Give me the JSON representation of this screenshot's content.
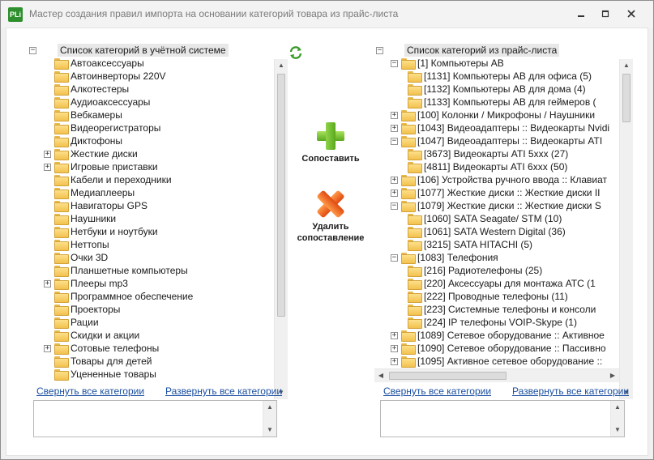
{
  "window": {
    "title": "Мастер создания правил импорта на основании категорий товара из прайс-листа",
    "app_icon_label": "PLi"
  },
  "left_tree": {
    "root_label": "Список категорий в учётной системе",
    "items": [
      {
        "label": "Автоаксессуары",
        "expandable": false
      },
      {
        "label": "Автоинверторы 220V",
        "expandable": false
      },
      {
        "label": "Алкотестеры",
        "expandable": false
      },
      {
        "label": "Аудиоаксессуары",
        "expandable": false
      },
      {
        "label": "Вебкамеры",
        "expandable": false
      },
      {
        "label": "Видеорегистраторы",
        "expandable": false
      },
      {
        "label": "Диктофоны",
        "expandable": false
      },
      {
        "label": "Жесткие диски",
        "expandable": true
      },
      {
        "label": "Игровые приставки",
        "expandable": true
      },
      {
        "label": "Кабели и переходники",
        "expandable": false
      },
      {
        "label": "Медиаплееры",
        "expandable": false
      },
      {
        "label": "Навигаторы GPS",
        "expandable": false
      },
      {
        "label": "Наушники",
        "expandable": false
      },
      {
        "label": "Нетбуки и ноутбуки",
        "expandable": false
      },
      {
        "label": "Неттопы",
        "expandable": false
      },
      {
        "label": "Очки 3D",
        "expandable": false
      },
      {
        "label": "Планшетные компьютеры",
        "expandable": false
      },
      {
        "label": "Плееры mp3",
        "expandable": true
      },
      {
        "label": "Программное обеспечение",
        "expandable": false
      },
      {
        "label": "Проекторы",
        "expandable": false
      },
      {
        "label": "Рации",
        "expandable": false
      },
      {
        "label": "Скидки и акции",
        "expandable": false
      },
      {
        "label": "Сотовые телефоны",
        "expandable": true
      },
      {
        "label": "Товары для детей",
        "expandable": false
      },
      {
        "label": "Уцененные товары",
        "expandable": false
      }
    ],
    "collapse_all_link": "Свернуть все категории",
    "expand_all_link": "Развернуть все категории"
  },
  "right_tree": {
    "root_label": "Список категорий из прайс-листа",
    "items": [
      {
        "label": "[1] Компьютеры AB",
        "level": 1,
        "expander": "minus"
      },
      {
        "label": "[1131] Компьютеры AB для офиса (5)",
        "level": 2,
        "expander": "none"
      },
      {
        "label": "[1132] Компьютеры AB для дома (4)",
        "level": 2,
        "expander": "none"
      },
      {
        "label": "[1133] Компьютеры AB для геймеров (",
        "level": 2,
        "expander": "none"
      },
      {
        "label": "[100] Колонки / Микрофоны / Наушники",
        "level": 1,
        "expander": "plus"
      },
      {
        "label": "[1043] Видеоадаптеры :: Видеокарты Nvidi",
        "level": 1,
        "expander": "plus"
      },
      {
        "label": "[1047] Видеоадаптеры :: Видеокарты ATI",
        "level": 1,
        "expander": "minus"
      },
      {
        "label": "[3673] Видеокарты ATI 5xxx (27)",
        "level": 2,
        "expander": "none"
      },
      {
        "label": "[4811] Видеокарты ATI 6xxx (50)",
        "level": 2,
        "expander": "none"
      },
      {
        "label": "[106] Устройства ручного ввода :: Клавиат",
        "level": 1,
        "expander": "plus"
      },
      {
        "label": "[1077] Жесткие диски :: Жесткие диски II",
        "level": 1,
        "expander": "plus"
      },
      {
        "label": "[1079] Жесткие диски :: Жесткие диски S",
        "level": 1,
        "expander": "minus"
      },
      {
        "label": "[1060] SATA Seagate/ STM (10)",
        "level": 2,
        "expander": "none"
      },
      {
        "label": "[1061] SATA Western Digital (36)",
        "level": 2,
        "expander": "none"
      },
      {
        "label": "[3215] SATA HITACHI (5)",
        "level": 2,
        "expander": "none"
      },
      {
        "label": "[1083] Телефония",
        "level": 1,
        "expander": "minus"
      },
      {
        "label": "[216] Радиотелефоны (25)",
        "level": 2,
        "expander": "none"
      },
      {
        "label": "[220] Аксессуары для монтажа АТС (1",
        "level": 2,
        "expander": "none"
      },
      {
        "label": "[222] Проводные телефоны (11)",
        "level": 2,
        "expander": "none"
      },
      {
        "label": "[223] Системные телефоны и консоли",
        "level": 2,
        "expander": "none"
      },
      {
        "label": "[224] IP телефоны VOIP-Skype (1)",
        "level": 2,
        "expander": "none"
      },
      {
        "label": "[1089] Сетевое оборудование :: Активное",
        "level": 1,
        "expander": "plus"
      },
      {
        "label": "[1090] Сетевое оборудование :: Пассивно",
        "level": 1,
        "expander": "plus"
      },
      {
        "label": "[1095] Активное сетевое оборудование ::",
        "level": 1,
        "expander": "plus"
      }
    ],
    "collapse_all_link": "Свернуть все категории",
    "expand_all_link": "Развернуть все категории"
  },
  "actions": {
    "match_label": "Сопоставить",
    "delete_label_line1": "Удалить",
    "delete_label_line2": "сопоставление"
  }
}
